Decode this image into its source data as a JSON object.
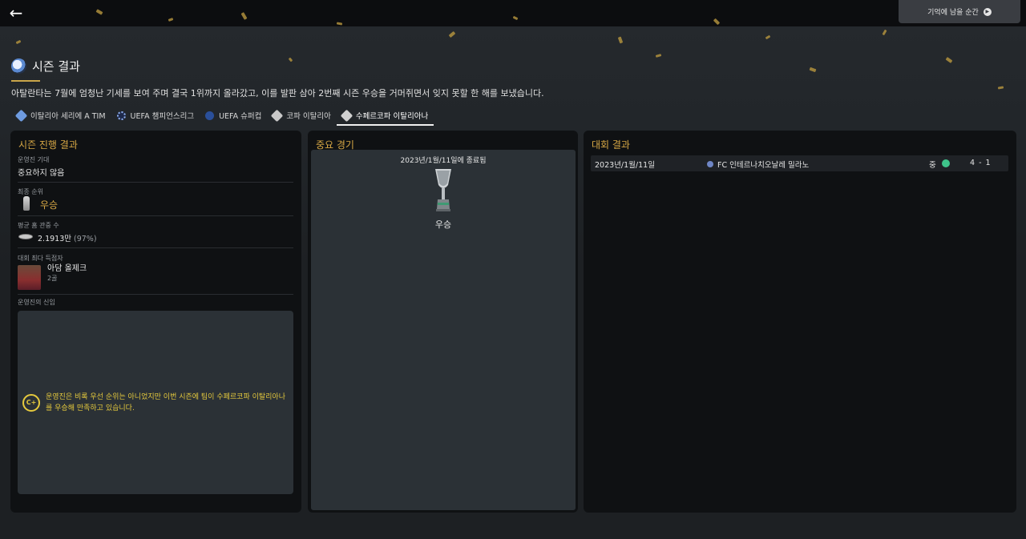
{
  "header": {
    "memory_button": "기억에 남을 순간"
  },
  "page": {
    "title": "시즌 결과",
    "summary": "아탈란타는 7월에 엄청난 기세를 보여 주며 결국 1위까지 올라갔고, 이를 발판 삼아 2번째 시즌 우승을 거머쥐면서 잊지 못할 한 해를 보냈습니다."
  },
  "tabs": [
    {
      "label": "이탈리아 세리에 A TIM",
      "color": "#6e9be0"
    },
    {
      "label": "UEFA 챔피언스리그",
      "color": "#8fb0f0"
    },
    {
      "label": "UEFA 슈퍼컵",
      "color": "#5a86d9"
    },
    {
      "label": "코파 이탈리아",
      "color": "#c8c8c8"
    },
    {
      "label": "수페르코파 이탈리아나",
      "color": "#d0d0d0"
    }
  ],
  "season_progress": {
    "title": "시즌 진행 결과",
    "expectation_label": "운영진 기대",
    "expectation_value": "중요하지 않음",
    "final_rank_label": "최종 순위",
    "final_rank_value": "우승",
    "attendance_label": "평균 홈 관중 수",
    "attendance_value": "2.1913만",
    "attendance_pct": "(97%)",
    "top_scorer_label": "대회 최다 득점자",
    "top_scorer_name": "아담 올제크",
    "top_scorer_goals": "2골",
    "confidence_label": "운영진의 신임",
    "grade": "C+",
    "confidence_text": "운영진은 비록 우선 순위는 아니었지만 이번 시즌에 팀이 수페르코파 이탈리아나를 우승해 만족하고 있습니다."
  },
  "important_matches": {
    "title": "중요 경기",
    "date": "2023년/1월/11일에 종료됨",
    "result": "우승"
  },
  "competition_results": {
    "title": "대회 결과",
    "rows": [
      {
        "date": "2023년/1월/11일",
        "opponent": "FC 인테르나치오날레 밀라노",
        "venue": "중",
        "score": "4 - 1",
        "outcome_color": "#3ec38a"
      }
    ]
  },
  "colors": {
    "accent_gold": "#d7a845",
    "grade_yellow": "#e5c93d",
    "win_green": "#3ec38a"
  }
}
